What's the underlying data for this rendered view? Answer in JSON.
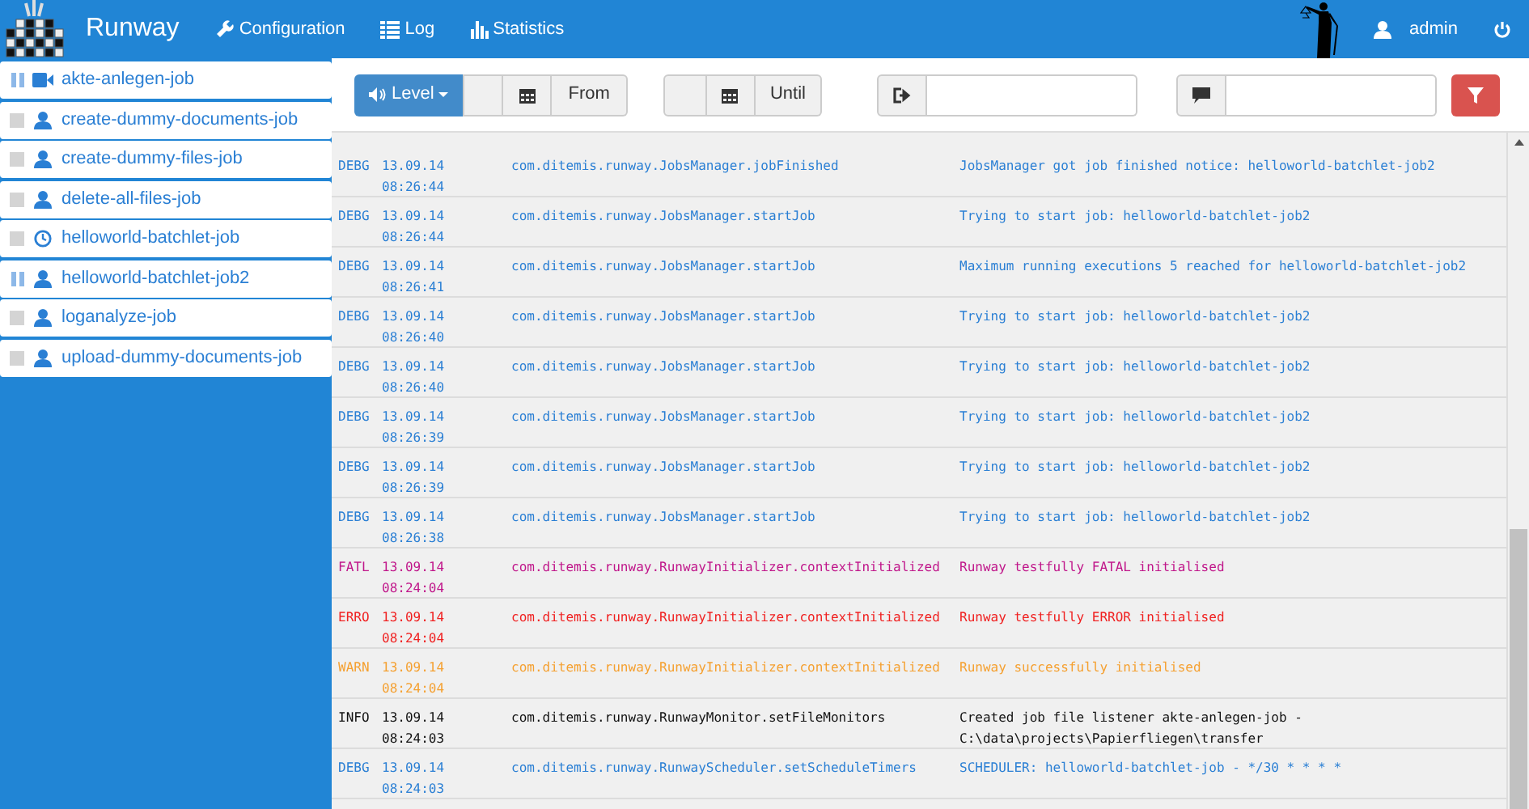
{
  "navbar": {
    "brand": "Runway",
    "links": [
      {
        "label": "Configuration"
      },
      {
        "label": "Log"
      },
      {
        "label": "Statistics"
      }
    ],
    "user": "admin"
  },
  "jobs": [
    {
      "name": "akte-anlegen-job",
      "paused": true,
      "kind": "video"
    },
    {
      "name": "create-dummy-documents-job",
      "paused": false,
      "kind": "manual"
    },
    {
      "name": "create-dummy-files-job",
      "paused": false,
      "kind": "manual"
    },
    {
      "name": "delete-all-files-job",
      "paused": false,
      "kind": "manual"
    },
    {
      "name": "helloworld-batchlet-job",
      "paused": false,
      "kind": "scheduled"
    },
    {
      "name": "helloworld-batchlet-job2",
      "paused": true,
      "kind": "manual"
    },
    {
      "name": "loganalyze-job",
      "paused": false,
      "kind": "manual"
    },
    {
      "name": "upload-dummy-documents-job",
      "paused": false,
      "kind": "manual"
    }
  ],
  "filters": {
    "level_button": "Level",
    "from_label": "From",
    "until_label": "Until"
  },
  "log": [
    {
      "level": "DEBG",
      "date": "13.09.14",
      "time": "08:26:44",
      "source": "com.ditemis.runway.JobsManager.jobFinished",
      "message": [
        "JobsManager got job finished notice: helloworld-batchlet-job2"
      ]
    },
    {
      "level": "DEBG",
      "date": "13.09.14",
      "time": "08:26:44",
      "source": "com.ditemis.runway.JobsManager.startJob",
      "message": [
        "Trying to start job: helloworld-batchlet-job2"
      ]
    },
    {
      "level": "DEBG",
      "date": "13.09.14",
      "time": "08:26:41",
      "source": "com.ditemis.runway.JobsManager.startJob",
      "message": [
        "Maximum running executions 5 reached for helloworld-batchlet-job2"
      ]
    },
    {
      "level": "DEBG",
      "date": "13.09.14",
      "time": "08:26:40",
      "source": "com.ditemis.runway.JobsManager.startJob",
      "message": [
        "Trying to start job: helloworld-batchlet-job2"
      ]
    },
    {
      "level": "DEBG",
      "date": "13.09.14",
      "time": "08:26:40",
      "source": "com.ditemis.runway.JobsManager.startJob",
      "message": [
        "Trying to start job: helloworld-batchlet-job2"
      ]
    },
    {
      "level": "DEBG",
      "date": "13.09.14",
      "time": "08:26:39",
      "source": "com.ditemis.runway.JobsManager.startJob",
      "message": [
        "Trying to start job: helloworld-batchlet-job2"
      ]
    },
    {
      "level": "DEBG",
      "date": "13.09.14",
      "time": "08:26:39",
      "source": "com.ditemis.runway.JobsManager.startJob",
      "message": [
        "Trying to start job: helloworld-batchlet-job2"
      ]
    },
    {
      "level": "DEBG",
      "date": "13.09.14",
      "time": "08:26:38",
      "source": "com.ditemis.runway.JobsManager.startJob",
      "message": [
        "Trying to start job: helloworld-batchlet-job2"
      ]
    },
    {
      "level": "FATL",
      "date": "13.09.14",
      "time": "08:24:04",
      "source": "com.ditemis.runway.RunwayInitializer.contextInitialized",
      "message": [
        "Runway testfully FATAL initialised"
      ]
    },
    {
      "level": "ERRO",
      "date": "13.09.14",
      "time": "08:24:04",
      "source": "com.ditemis.runway.RunwayInitializer.contextInitialized",
      "message": [
        "Runway testfully ERROR initialised"
      ]
    },
    {
      "level": "WARN",
      "date": "13.09.14",
      "time": "08:24:04",
      "source": "com.ditemis.runway.RunwayInitializer.contextInitialized",
      "message": [
        "Runway successfully initialised"
      ]
    },
    {
      "level": "INFO",
      "date": "13.09.14",
      "time": "08:24:03",
      "source": "com.ditemis.runway.RunwayMonitor.setFileMonitors",
      "message": [
        "Created job file listener akte-anlegen-job -",
        "C:\\data\\projects\\Papierfliegen\\transfer"
      ]
    },
    {
      "level": "DEBG",
      "date": "13.09.14",
      "time": "08:24:03",
      "source": "com.ditemis.runway.RunwayScheduler.setScheduleTimers",
      "message": [
        "SCHEDULER: helloworld-batchlet-job - */30 * * * *"
      ]
    }
  ]
}
